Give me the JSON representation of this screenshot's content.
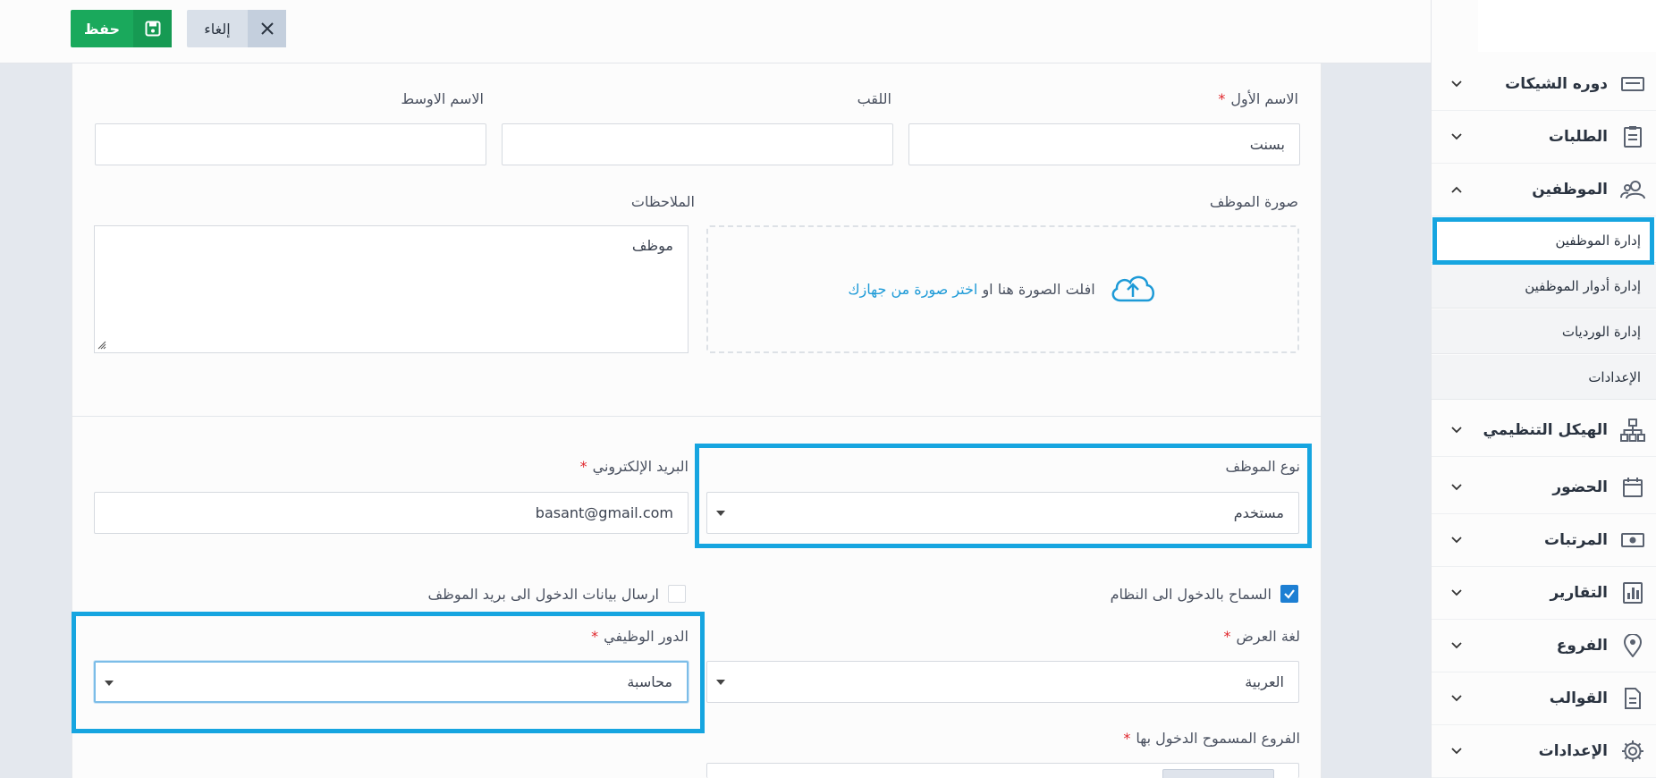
{
  "toolbar": {
    "save_label": "حفظ",
    "cancel_label": "إلغاء"
  },
  "form": {
    "first_name_label": "الاسم الأول",
    "first_name_value": "بسنت",
    "last_name_label": "اللقب",
    "last_name_value": "",
    "middle_name_label": "الاسم الاوسط",
    "middle_name_value": "",
    "photo_label": "صورة الموظف",
    "photo_drop_text": "افلت الصورة هنا او",
    "photo_choose_link": "اختر صورة من جهازك",
    "notes_label": "الملاحظات",
    "notes_value": "موظف",
    "employee_type_label": "نوع الموظف",
    "employee_type_value": "مستخدم",
    "email_label": "البريد الإلكتروني",
    "email_value": "basant@gmail.com",
    "allow_login_label": "السماح بالدخول الى النظام",
    "allow_login_checked": true,
    "send_credentials_label": "ارسال بيانات الدخول الى بريد الموظف",
    "send_credentials_checked": false,
    "display_language_label": "لغة العرض",
    "display_language_value": "العربية",
    "job_role_label": "الدور الوظيفي",
    "job_role_value": "محاسبة",
    "allowed_branches_label": "الفروع المسموح الدخول بها",
    "required_mark": "*"
  },
  "sidebar": {
    "items": [
      {
        "label": "دوره الشيكات",
        "icon": "check-card-icon"
      },
      {
        "label": "الطلبات",
        "icon": "clipboard-icon"
      },
      {
        "label": "الموظفين",
        "icon": "users-icon"
      },
      {
        "label": "الهيكل التنظيمي",
        "icon": "org-chart-icon"
      },
      {
        "label": "الحضور",
        "icon": "calendar-icon"
      },
      {
        "label": "المرتبات",
        "icon": "money-icon"
      },
      {
        "label": "التقارير",
        "icon": "bar-chart-icon"
      },
      {
        "label": "الفروع",
        "icon": "location-pin-icon"
      },
      {
        "label": "القوالب",
        "icon": "document-icon"
      },
      {
        "label": "الإعدادات",
        "icon": "gear-icon"
      }
    ],
    "employees_sub": [
      {
        "label": "إدارة الموظفين"
      },
      {
        "label": "إدارة أدوار الموظفين"
      },
      {
        "label": "إدارة الورديات"
      },
      {
        "label": "الإعدادات"
      }
    ]
  },
  "colors": {
    "primary_green": "#1aa95c",
    "highlight_blue": "#16a5e0",
    "link_blue": "#1d9ad7",
    "required_red": "#e0262c"
  }
}
